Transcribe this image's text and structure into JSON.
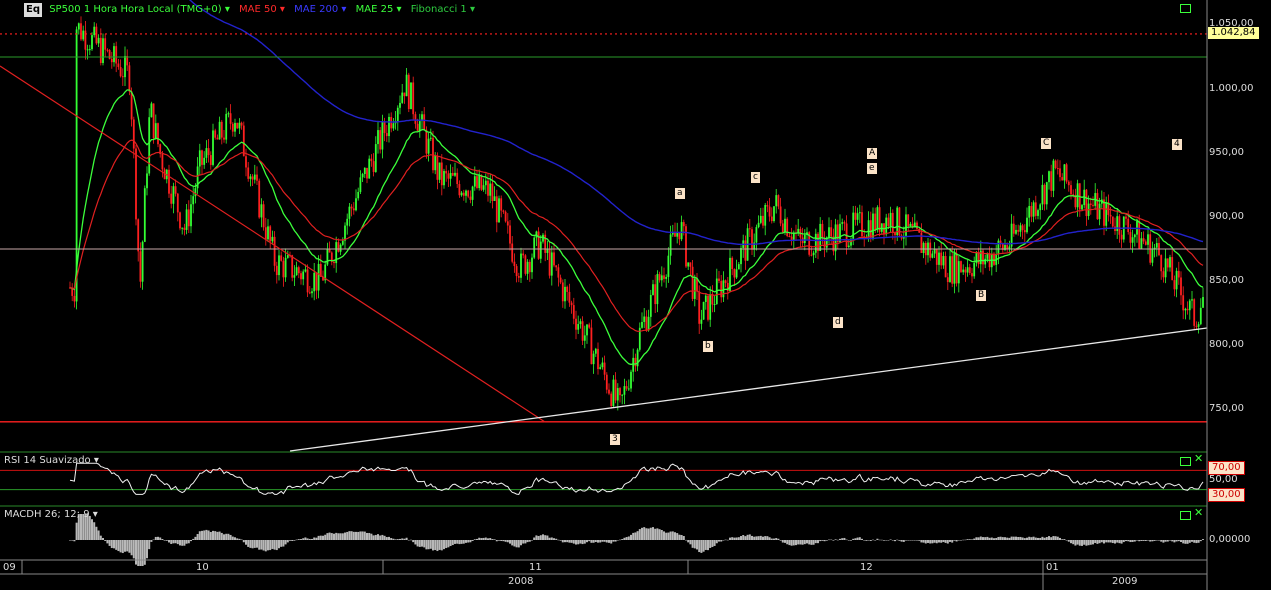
{
  "header": {
    "logo": "Eq",
    "symbol": "SP500",
    "interval": "1 Hora Hora Local (TMG+0)",
    "indicators": [
      {
        "label": "MAE 50",
        "color": "#ff2a2a"
      },
      {
        "label": "MAE 200",
        "color": "#3a3aff"
      },
      {
        "label": "MAE 25",
        "color": "#3bff3b"
      },
      {
        "label": "Fibonacci 1",
        "color": "#2ecc40"
      }
    ]
  },
  "price_axis": {
    "ticks": [
      "1.050,00",
      "1.000,00",
      "950,00",
      "900,00",
      "850,00",
      "800,00",
      "750,00"
    ],
    "last_price": "1.042,84"
  },
  "rsi_panel": {
    "title": "RSI 14 Suavizado",
    "ticks": [
      "70,00",
      "50,00",
      "30,00"
    ]
  },
  "macd_panel": {
    "title": "MACDH 26; 12; 9",
    "ticks": [
      "0,00000"
    ]
  },
  "time_axis": {
    "month_labels": [
      "09",
      "10",
      "11",
      "12",
      "01"
    ],
    "year_labels": [
      "2008",
      "2009"
    ]
  },
  "wave_labels": [
    "3",
    "a",
    "b",
    "c",
    "d",
    "A",
    "e",
    "B",
    "C",
    "4"
  ],
  "chart_data": {
    "type": "candlestick",
    "title": "SP500",
    "ylim": [
      735,
      1060
    ],
    "grid": false,
    "legend": "top-left",
    "x_periods": [
      "2008-09",
      "2008-10",
      "2008-11",
      "2008-12",
      "2009-01"
    ],
    "anchors": {
      "dates": [
        "Sep-30",
        "Oct-06",
        "Oct-08",
        "Oct-10",
        "Oct-13",
        "Oct-16",
        "Oct-17",
        "Oct-20",
        "Oct-23",
        "Oct-27",
        "Nov-04",
        "Nov-06",
        "Nov-10",
        "Nov-13",
        "Nov-17",
        "Nov-20",
        "Nov-21",
        "Nov-24",
        "Nov-28",
        "Dec-01",
        "Dec-05",
        "Dec-08",
        "Dec-10",
        "Dec-12",
        "Dec-16",
        "Dec-19",
        "Dec-23",
        "Dec-29",
        "Jan-06",
        "Jan-08",
        "Jan-12",
        "Jan-15",
        "Jan-20",
        "Jan-21"
      ],
      "close": [
        1050,
        1010,
        985,
        845,
        950,
        890,
        940,
        980,
        865,
        850,
        1005,
        930,
        920,
        860,
        880,
        800,
        750,
        810,
        895,
        820,
        870,
        910,
        880,
        885,
        900,
        860,
        865,
        880,
        935,
        910,
        890,
        870,
        820,
        845
      ]
    },
    "reference_levels": {
      "red_dotted": 1043,
      "green_line": 1025,
      "gray_line": 875,
      "red_line": 740
    },
    "moving_averages": [
      "MAE 25",
      "MAE 50",
      "MAE 200"
    ],
    "rsi_levels": [
      70,
      30
    ],
    "macd_zero": 0
  },
  "colors": {
    "up": "#33ff33",
    "down": "#ff2020",
    "mae25": "#3bff3b",
    "mae50": "#e02020",
    "mae200": "#2222cc",
    "trend_white": "#e8e8e8",
    "background": "#000000"
  }
}
